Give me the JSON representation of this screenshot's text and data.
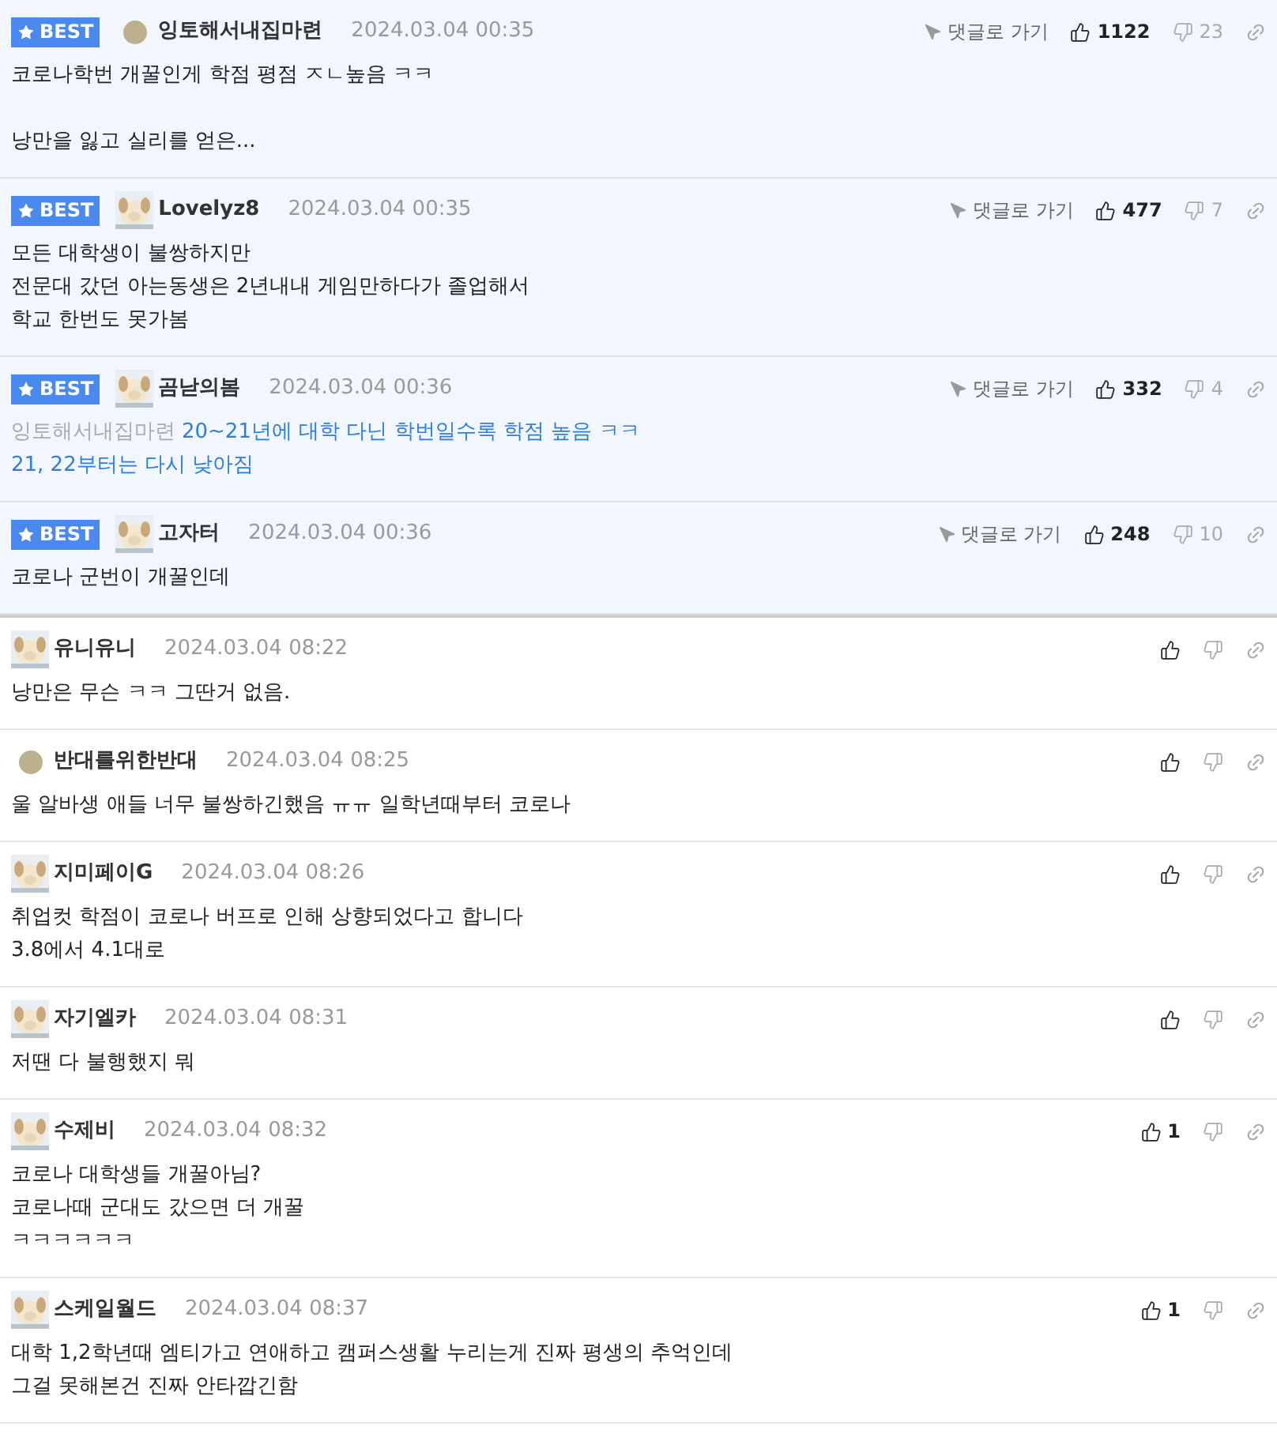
{
  "comments": [
    {
      "best": true,
      "badge": "BEST",
      "avatar": {
        "kind": "default"
      },
      "author": "잉토해서내집마련",
      "date": "2024.03.04 00:35",
      "goto_label": "댓글로 가기",
      "likes": "1122",
      "dislikes": "23",
      "paragraphs": [
        [
          "코로나학번 개꿀인게 학점 평점 ㅈㄴ높음 ㅋㅋ"
        ],
        [
          "낭만을 잃고 실리를 얻은..."
        ]
      ]
    },
    {
      "best": true,
      "badge": "BEST",
      "avatar": {
        "kind": "picture"
      },
      "author": "Lovelyz8",
      "date": "2024.03.04 00:35",
      "goto_label": "댓글로 가기",
      "likes": "477",
      "dislikes": "7",
      "paragraphs": [
        [
          "모든 대학생이 불쌍하지만",
          "전문대 갔던 아는동생은 2년내내 게임만하다가 졸업해서",
          "학교 한번도 못가봄"
        ]
      ]
    },
    {
      "best": true,
      "badge": "BEST",
      "avatar": {
        "kind": "picture"
      },
      "author": "곰낟의봄",
      "date": "2024.03.04 00:36",
      "goto_label": "댓글로 가기",
      "likes": "332",
      "dislikes": "4",
      "reply_to": "잉토해서내집마련",
      "paragraphs": [
        [
          "20~21년에 대학 다닌 학번일수록 학점 높음 ㅋㅋ",
          "21, 22부터는 다시 낮아짐"
        ]
      ]
    },
    {
      "best": true,
      "badge": "BEST",
      "avatar": {
        "kind": "picture"
      },
      "author": "고자터",
      "date": "2024.03.04 00:36",
      "goto_label": "댓글로 가기",
      "likes": "248",
      "dislikes": "10",
      "paragraphs": [
        [
          "코로나 군번이 개꿀인데"
        ]
      ]
    },
    {
      "best": false,
      "avatar": {
        "kind": "picture"
      },
      "author": "유니유니",
      "date": "2024.03.04 08:22",
      "paragraphs": [
        [
          "낭만은 무슨 ㅋㅋ 그딴거 없음."
        ]
      ]
    },
    {
      "best": false,
      "avatar": {
        "kind": "default"
      },
      "author": "반대를위한반대",
      "date": "2024.03.04 08:25",
      "paragraphs": [
        [
          "울 알바생 애들 너무 불쌍하긴했음 ㅠㅠ 일학년때부터 코로나"
        ]
      ]
    },
    {
      "best": false,
      "avatar": {
        "kind": "picture"
      },
      "author": "지미페이G",
      "date": "2024.03.04 08:26",
      "paragraphs": [
        [
          "취업컷 학점이 코로나 버프로 인해 상향되었다고 합니다",
          "3.8에서 4.1대로"
        ]
      ]
    },
    {
      "best": false,
      "avatar": {
        "kind": "picture"
      },
      "author": "자기엘카",
      "date": "2024.03.04 08:31",
      "paragraphs": [
        [
          "저땐 다 불행했지 뭐"
        ]
      ]
    },
    {
      "best": false,
      "avatar": {
        "kind": "picture"
      },
      "author": "수제비",
      "date": "2024.03.04 08:32",
      "likes": "1",
      "paragraphs": [
        [
          "코로나 대학생들 개꿀아님?",
          "코로나때 군대도 갔으면 더 개꿀",
          "ㅋㅋㅋㅋㅋㅋ"
        ]
      ]
    },
    {
      "best": false,
      "avatar": {
        "kind": "picture"
      },
      "author": "스케일월드",
      "date": "2024.03.04 08:37",
      "likes": "1",
      "paragraphs": [
        [
          "대학 1,2학년때 엠티가고 연애하고 캠퍼스생활 누리는게 진짜 평생의 추억인데",
          "그걸 못해본건 진짜 안타깝긴함"
        ]
      ]
    }
  ]
}
